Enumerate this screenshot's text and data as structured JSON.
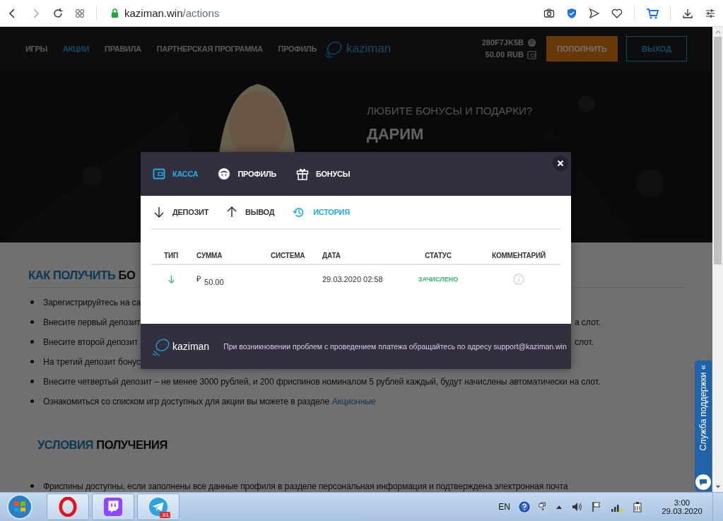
{
  "browser": {
    "domain": "kaziman.win",
    "path": "/actions"
  },
  "header": {
    "nav": [
      {
        "label": "ИГРЫ",
        "selected": false
      },
      {
        "label": "АКЦИИ",
        "selected": true
      },
      {
        "label": "ПРАВИЛА",
        "selected": false
      },
      {
        "label": "ПАРТНЕРСКАЯ ПРОГРАММА",
        "selected": false
      },
      {
        "label": "ПРОФИЛЬ",
        "selected": false
      }
    ],
    "logo": "kaziman",
    "account_id": "280F7JK5B",
    "balance": "50.00 RUB",
    "deposit_button": "ПОПОЛНИТЬ",
    "logout_button": "ВЫХОД"
  },
  "banner": {
    "kind": "picture",
    "headline": "ЛЮБИТЕ БОНУСЫ И ПОДАРКИ?",
    "subheadline": "ДАРИМ"
  },
  "content": {
    "heading_1": [
      {
        "text": "КАК ПОЛУЧИТЬ",
        "accent": true
      },
      {
        "text": "БО",
        "accent": false
      }
    ],
    "items": [
      {
        "left": "Зарегистрируйтесь на са"
      },
      {
        "left": "Внесите первый депозит",
        "right": "а слот."
      },
      {
        "left": "Внесите второй депозит",
        "right": "слот."
      },
      {
        "left": "На третий депозит бонус"
      },
      {
        "left": "Внесите четвертый депозит – не менее 3000 рублей, и 200 фриспинов номиналом 5 рублей каждый, будут начислены автоматически на слот."
      },
      {
        "left": "Ознакомиться со списком игр доступных для акции вы можете в разделе",
        "link": "Акционные"
      }
    ],
    "heading_2": [
      {
        "text": "УСЛОВИЯ",
        "accent": true
      },
      {
        "text": "ПОЛУЧЕНИЯ",
        "accent": false
      }
    ],
    "items_2": [
      {
        "left": "Фриспины доступны, если заполнены все данные профиля в разделе персональная информация и подтверждена электронная почта"
      }
    ]
  },
  "modal": {
    "tabs": [
      {
        "label": "КАССА",
        "kind": "wallet",
        "selected": true
      },
      {
        "label": "ПРОФИЛЬ",
        "kind": "face",
        "selected": false
      },
      {
        "label": "БОНУСЫ",
        "kind": "gift",
        "selected": false
      }
    ],
    "subtabs": [
      {
        "label": "ДЕПОЗИТ",
        "kind": "down",
        "selected": false
      },
      {
        "label": "ВЫВОД",
        "kind": "up",
        "selected": false
      },
      {
        "label": "ИСТОРИЯ",
        "kind": "history",
        "selected": true
      }
    ],
    "columns": [
      "ТИП",
      "СУММА",
      "СИСТЕМА",
      "ДАТА",
      "СТАТУС",
      "КОММЕНТАРИЙ"
    ],
    "rows": [
      {
        "kind": "deposit",
        "currency": "₽",
        "amount": "50.00",
        "date": "29.03.2020 02:58",
        "status": "ЗАЧИСЛЕНО"
      }
    ],
    "footer_logo": "kaziman",
    "footer_note": "При возникновении проблем с проведением платежа обращайтесь по адресу support@kaziman.win"
  },
  "support": {
    "label": "Служба поддержки",
    "toggle": "«"
  },
  "taskbar": {
    "apps": [
      {
        "kind": "opera"
      },
      {
        "kind": "twitch"
      },
      {
        "kind": "telegram",
        "badge": ".91"
      }
    ],
    "language": "EN",
    "time": "3:00",
    "date": "29.03.2020"
  }
}
